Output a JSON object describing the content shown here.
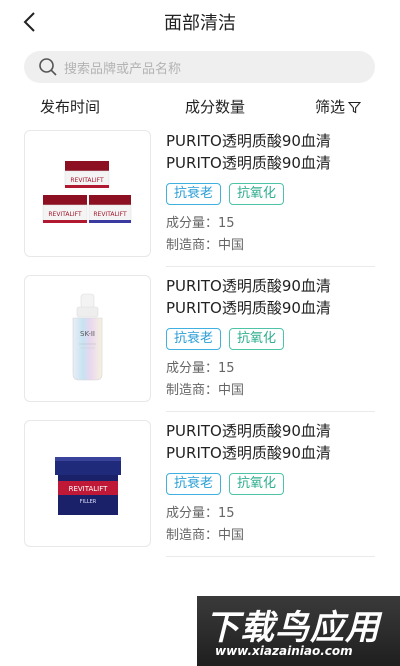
{
  "header": {
    "title": "面部清洁",
    "back_icon": "chevron-left-icon"
  },
  "search": {
    "placeholder": "搜索品牌或产品名称",
    "icon": "search-icon"
  },
  "filters": {
    "sort_time": "发布时间",
    "sort_count": "成分数量",
    "filter_label": "筛选",
    "filter_icon": "funnel-icon"
  },
  "products": [
    {
      "name": "PURITO透明质酸90血清PURITO透明质酸90血清",
      "tags": [
        "抗衰老",
        "抗氧化"
      ],
      "ingredients": "成分量：15",
      "maker": "制造商：中国"
    },
    {
      "name": "PURITO透明质酸90血清PURITO透明质酸90血清",
      "tags": [
        "抗衰老",
        "抗氧化"
      ],
      "ingredients": "成分量：15",
      "maker": "制造商：中国"
    },
    {
      "name": "PURITO透明质酸90血清PURITO透明质酸90血清",
      "tags": [
        "抗衰老",
        "抗氧化"
      ],
      "ingredients": "成分量：15",
      "maker": "制造商：中国"
    }
  ],
  "watermark": {
    "main": "下载鸟应用",
    "url": "www.xiazainiao.com"
  },
  "colors": {
    "tag_blue": "#2a9ed6",
    "tag_green": "#2eae8e",
    "search_bg": "#efefef"
  }
}
